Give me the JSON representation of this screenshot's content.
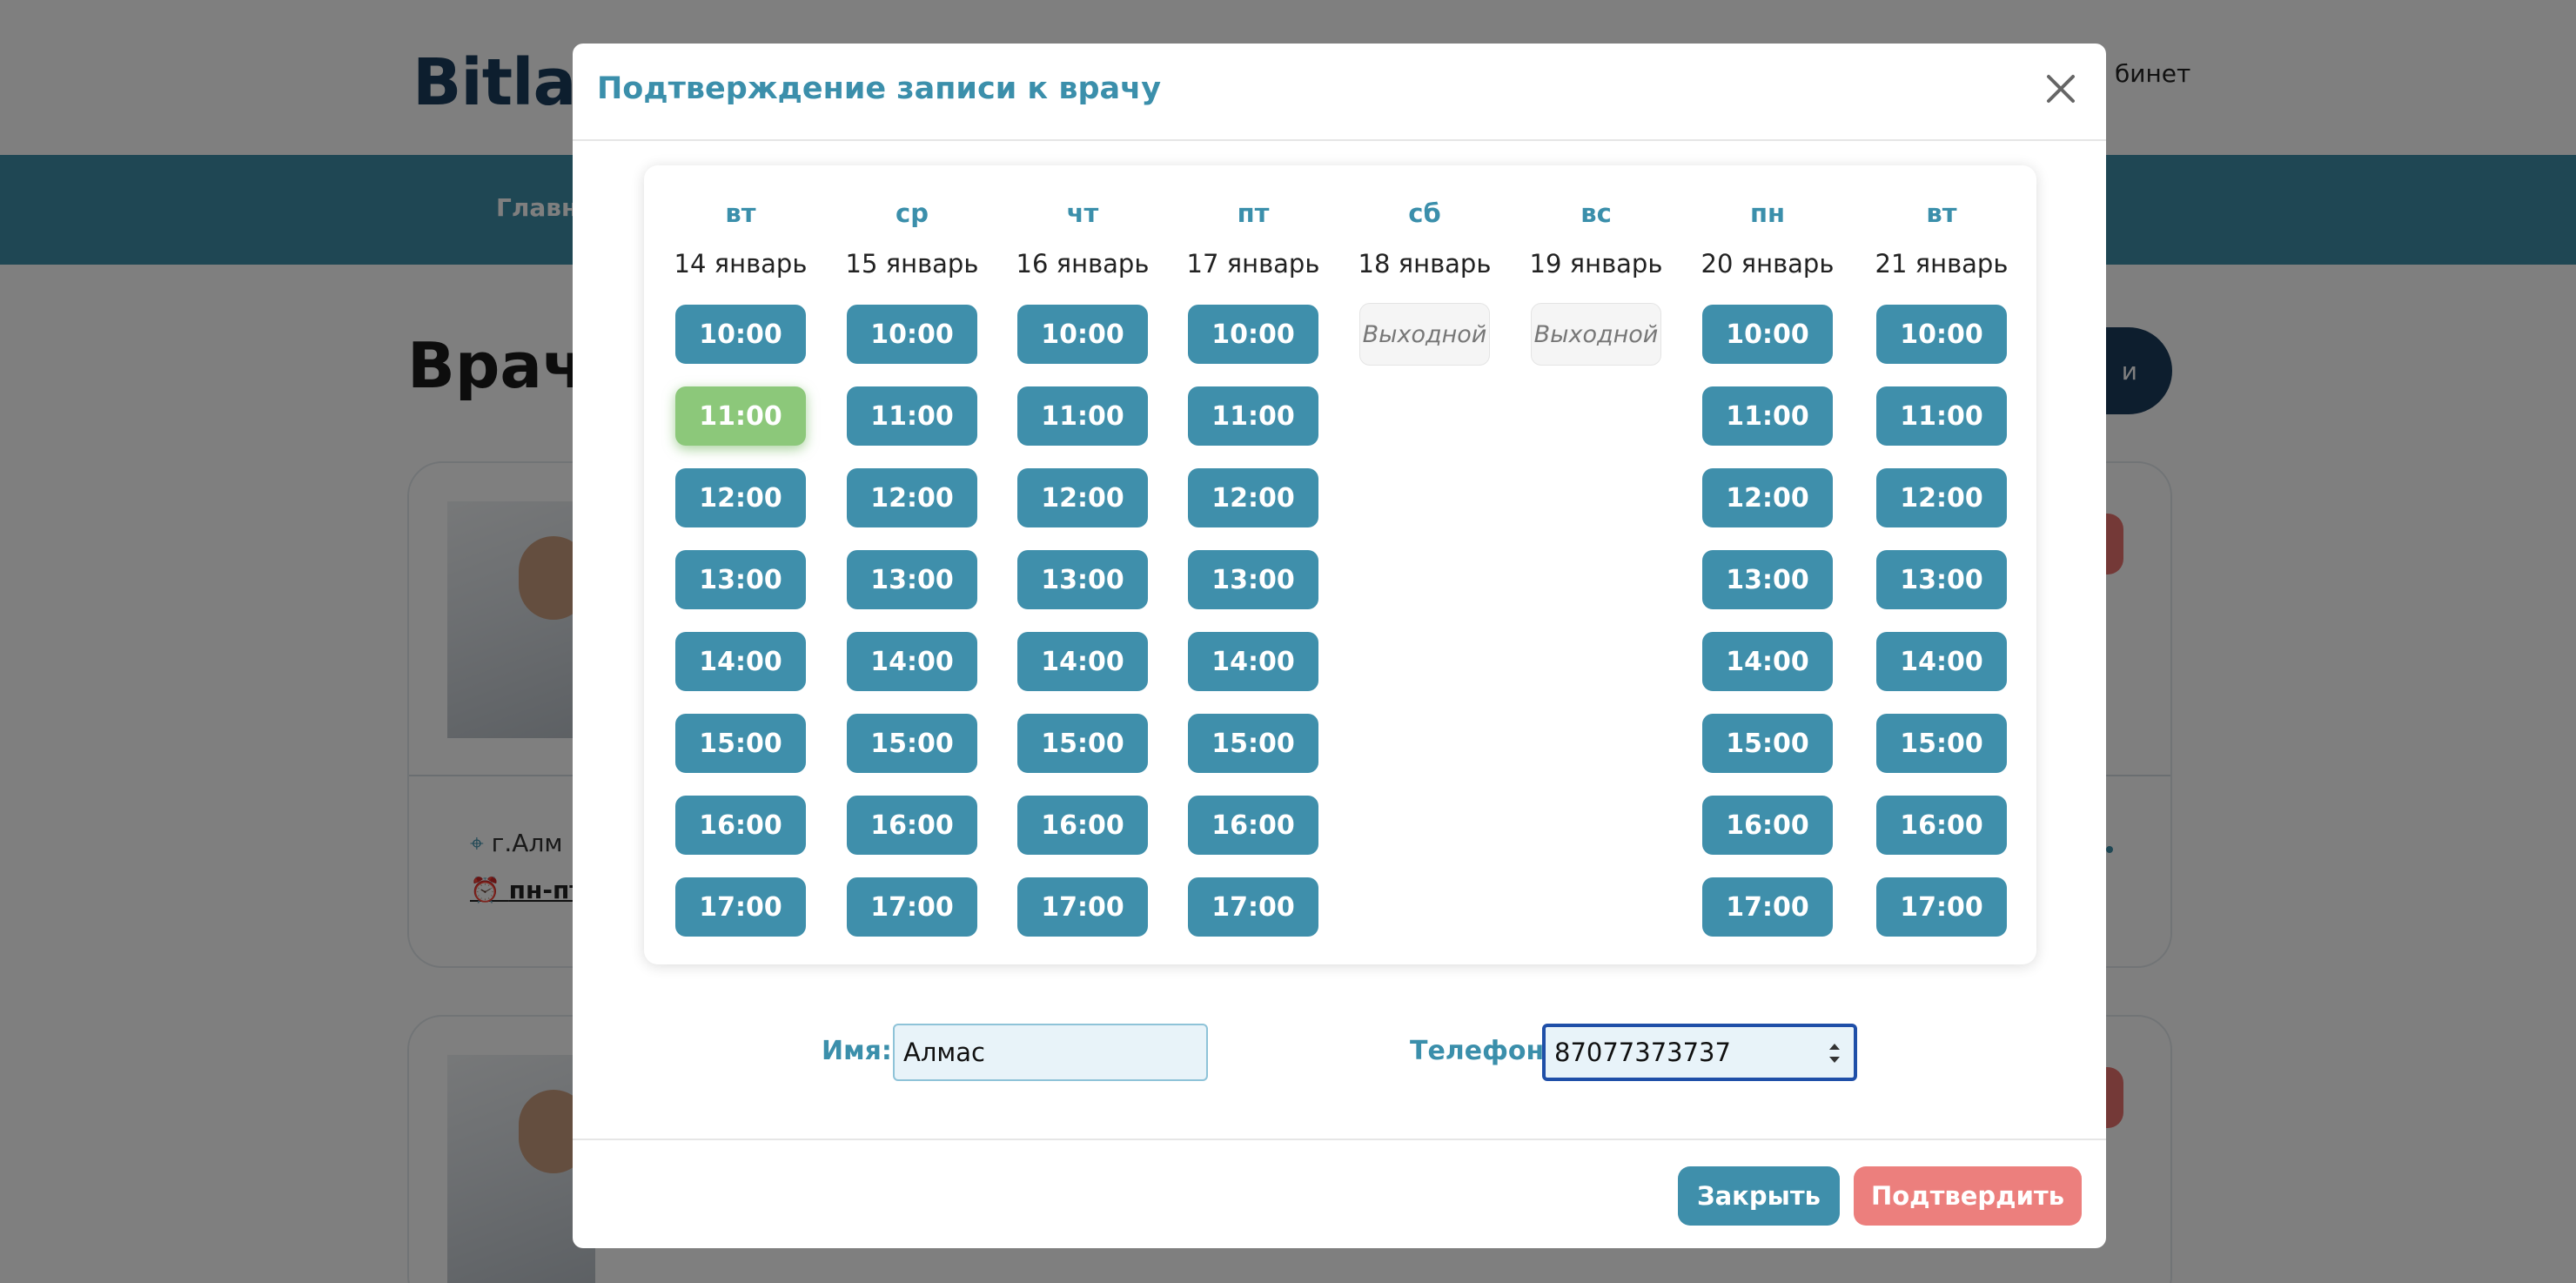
{
  "background": {
    "logo": "Bitlab",
    "cabinet_link": "бинет",
    "nav_item": "Главн",
    "heading": "Врач",
    "search_button": "и",
    "card1_location": "г.Алм",
    "card1_hours": "пн-пт"
  },
  "modal": {
    "title": "Подтверждение записи к врачу",
    "close_icon": "close-icon",
    "days": [
      {
        "name": "вт",
        "date": "14 январь",
        "dayoff": false,
        "selected": "11:00"
      },
      {
        "name": "ср",
        "date": "15 январь",
        "dayoff": false
      },
      {
        "name": "чт",
        "date": "16 январь",
        "dayoff": false
      },
      {
        "name": "пт",
        "date": "17 январь",
        "dayoff": false
      },
      {
        "name": "сб",
        "date": "18 январь",
        "dayoff": true
      },
      {
        "name": "вс",
        "date": "19 январь",
        "dayoff": true
      },
      {
        "name": "пн",
        "date": "20 январь",
        "dayoff": false
      },
      {
        "name": "вт",
        "date": "21 январь",
        "dayoff": false
      }
    ],
    "time_slots": [
      "10:00",
      "11:00",
      "12:00",
      "13:00",
      "14:00",
      "15:00",
      "16:00",
      "17:00"
    ],
    "dayoff_label": "Выходной",
    "form": {
      "name_label": "Имя:",
      "name_value": "Алмас",
      "phone_label": "Телефон:",
      "phone_value": "87077373737"
    },
    "footer": {
      "close_label": "Закрыть",
      "confirm_label": "Подтвердить"
    }
  },
  "colors": {
    "accent": "#3f8fab",
    "selected_slot": "#8cc87a",
    "confirm": "#ec7f7d"
  }
}
